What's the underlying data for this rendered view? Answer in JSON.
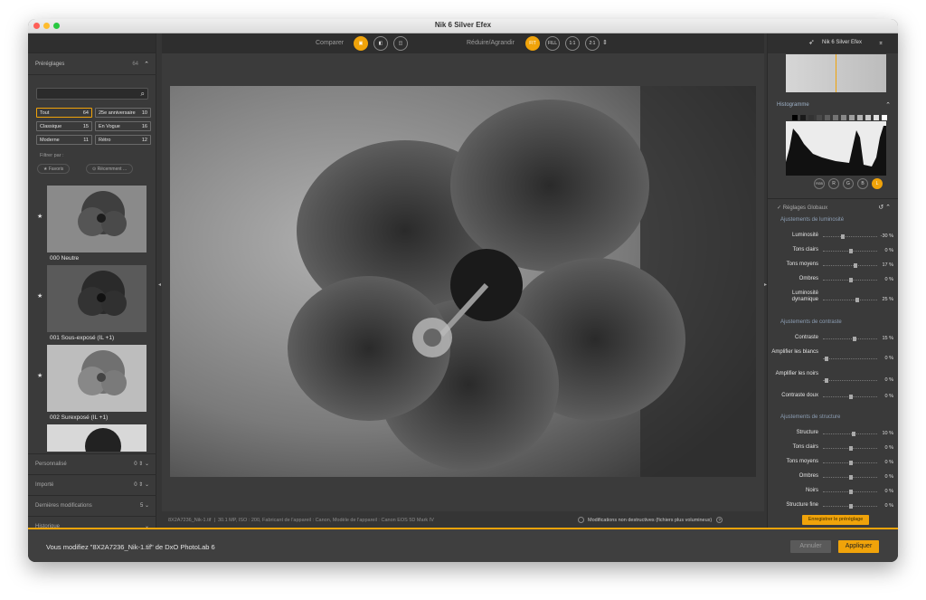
{
  "app": {
    "title": "Nik 6 Silver Efex"
  },
  "left_panel": {
    "presets": {
      "label": "Préréglages",
      "count": "64"
    },
    "categories": [
      {
        "name": "Tout",
        "count": "64",
        "selected": true
      },
      {
        "name": "25e anniversaire",
        "count": "10"
      },
      {
        "name": "Classique",
        "count": "15"
      },
      {
        "name": "En Vogue",
        "count": "16"
      },
      {
        "name": "Moderne",
        "count": "11"
      },
      {
        "name": "Rétro",
        "count": "12"
      }
    ],
    "filter_label": "Filtrer par :",
    "filters": [
      "Favoris",
      "Récemment ..."
    ],
    "thumbs": [
      {
        "label": "000 Neutre"
      },
      {
        "label": "001 Sous-exposé (IL +1)"
      },
      {
        "label": "002 Surexposé (IL +1)"
      }
    ],
    "sections": [
      {
        "label": "Personnalisé",
        "count": "0"
      },
      {
        "label": "Importé",
        "count": "0"
      },
      {
        "label": "Dernières modifications",
        "count": "5"
      },
      {
        "label": "Historique",
        "count": ""
      }
    ]
  },
  "toolbar": {
    "compare_label": "Comparer",
    "zoom_label": "Réduire/Agrandir",
    "zoom_buttons": [
      "FIT",
      "FILL",
      "1:1",
      "2:1"
    ]
  },
  "status": {
    "file": "8X2A7236_Nik-1.tif",
    "info": "30.1 MP, ISO : 200, Fabricant de l'appareil : Canon, Modèle de l'appareil : Canon EOS 5D Mark IV",
    "nondestructive": "Modifications non destructives (fichiers plus volumineux)"
  },
  "right_panel": {
    "title": "Nik 6 Silver Efex",
    "histogram_label": "Histogramme",
    "channels": [
      "RGB",
      "R",
      "G",
      "B",
      "L"
    ],
    "global_label": "Réglages Globaux",
    "groups": [
      {
        "title": "Ajustements de luminosité",
        "sliders": [
          {
            "label": "Luminosité",
            "value": "-30 %",
            "pos": 0.35
          },
          {
            "label": "Tons clairs",
            "value": "0 %",
            "pos": 0.5
          },
          {
            "label": "Tons moyens",
            "value": "17 %",
            "pos": 0.58
          },
          {
            "label": "Ombres",
            "value": "0 %",
            "pos": 0.5
          },
          {
            "label": "Luminosité dynamique",
            "value": "25 %",
            "pos": 0.62
          }
        ]
      },
      {
        "title": "Ajustements de contraste",
        "sliders": [
          {
            "label": "Contraste",
            "value": "15 %",
            "pos": 0.57
          },
          {
            "label": "Amplifier les blancs",
            "value": "0 %",
            "pos": 0.03
          },
          {
            "label": "Amplifier les noirs",
            "value": "0 %",
            "pos": 0.03
          },
          {
            "label": "Contraste doux",
            "value": "0 %",
            "pos": 0.5
          }
        ]
      },
      {
        "title": "Ajustements de structure",
        "sliders": [
          {
            "label": "Structure",
            "value": "10 %",
            "pos": 0.55
          },
          {
            "label": "Tons clairs",
            "value": "0 %",
            "pos": 0.5
          },
          {
            "label": "Tons moyens",
            "value": "0 %",
            "pos": 0.5
          },
          {
            "label": "Ombres",
            "value": "0 %",
            "pos": 0.5
          },
          {
            "label": "Noirs",
            "value": "0 %",
            "pos": 0.5
          },
          {
            "label": "Structure fine",
            "value": "0 %",
            "pos": 0.5
          }
        ]
      }
    ],
    "save_preset": "Enregistrer le préréglage"
  },
  "bottom": {
    "message": "Vous modifiez \"8X2A7236_Nik-1.tif\" de DxO PhotoLab 6",
    "cancel": "Annuler",
    "apply": "Appliquer"
  }
}
